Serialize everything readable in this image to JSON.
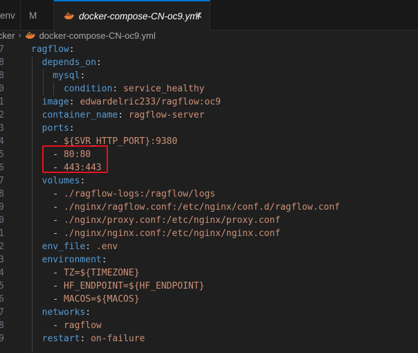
{
  "tabs": [
    {
      "label": "env"
    },
    {
      "label": "M"
    },
    {
      "label": "docker-compose-CN-oc9.yml",
      "active": true
    }
  ],
  "breadcrumb": {
    "folder": "cker",
    "file": "docker-compose-CN-oc9.yml"
  },
  "colors": {
    "key": "#569cd6",
    "value": "#ce9178",
    "punct": "#cccccc",
    "accent": "#0078d4",
    "annotation": "#e81123"
  },
  "lines": [
    {
      "n": "7",
      "segs": [
        {
          "t": "ragflow",
          "c": "k"
        },
        {
          "t": ":",
          "c": "p"
        }
      ]
    },
    {
      "n": "8",
      "segs": [
        {
          "t": "  depends_on",
          "c": "k"
        },
        {
          "t": ":",
          "c": "p"
        }
      ]
    },
    {
      "n": "8",
      "segs": [
        {
          "t": "    mysql",
          "c": "k"
        },
        {
          "t": ":",
          "c": "p"
        }
      ]
    },
    {
      "n": "0",
      "segs": [
        {
          "t": "      condition",
          "c": "k"
        },
        {
          "t": ": ",
          "c": "p"
        },
        {
          "t": "service_healthy",
          "c": "v"
        }
      ]
    },
    {
      "n": "1",
      "segs": [
        {
          "t": "  image",
          "c": "k"
        },
        {
          "t": ": ",
          "c": "p"
        },
        {
          "t": "edwardelric233/ragflow:oc9",
          "c": "v"
        }
      ]
    },
    {
      "n": "2",
      "segs": [
        {
          "t": "  container_name",
          "c": "k"
        },
        {
          "t": ": ",
          "c": "p"
        },
        {
          "t": "ragflow-server",
          "c": "v"
        }
      ]
    },
    {
      "n": "3",
      "segs": [
        {
          "t": "  ports",
          "c": "k"
        },
        {
          "t": ":",
          "c": "p"
        }
      ]
    },
    {
      "n": "4",
      "segs": [
        {
          "t": "    - ",
          "c": "p"
        },
        {
          "t": "${SVR_HTTP_PORT}:9380",
          "c": "v"
        }
      ]
    },
    {
      "n": "5",
      "segs": [
        {
          "t": "    - ",
          "c": "p"
        },
        {
          "t": "80:80",
          "c": "v"
        }
      ]
    },
    {
      "n": "6",
      "segs": [
        {
          "t": "    - ",
          "c": "p"
        },
        {
          "t": "443:443",
          "c": "v"
        }
      ]
    },
    {
      "n": "7",
      "segs": [
        {
          "t": "  volumes",
          "c": "k"
        },
        {
          "t": ":",
          "c": "p"
        }
      ]
    },
    {
      "n": "8",
      "segs": [
        {
          "t": "    - ",
          "c": "p"
        },
        {
          "t": "./ragflow-logs:/ragflow/logs",
          "c": "v"
        }
      ]
    },
    {
      "n": "9",
      "segs": [
        {
          "t": "    - ",
          "c": "p"
        },
        {
          "t": "./nginx/ragflow.conf:/etc/nginx/conf.d/ragflow.conf",
          "c": "v"
        }
      ]
    },
    {
      "n": "0",
      "segs": [
        {
          "t": "    - ",
          "c": "p"
        },
        {
          "t": "./nginx/proxy.conf:/etc/nginx/proxy.conf",
          "c": "v"
        }
      ]
    },
    {
      "n": "1",
      "segs": [
        {
          "t": "    - ",
          "c": "p"
        },
        {
          "t": "./nginx/nginx.conf:/etc/nginx/nginx.conf",
          "c": "v"
        }
      ]
    },
    {
      "n": "2",
      "segs": [
        {
          "t": "  env_file",
          "c": "k"
        },
        {
          "t": ": ",
          "c": "p"
        },
        {
          "t": ".env",
          "c": "v"
        }
      ]
    },
    {
      "n": "3",
      "segs": [
        {
          "t": "  environment",
          "c": "k"
        },
        {
          "t": ":",
          "c": "p"
        }
      ]
    },
    {
      "n": "4",
      "segs": [
        {
          "t": "    - ",
          "c": "p"
        },
        {
          "t": "TZ=${TIMEZONE}",
          "c": "v"
        }
      ]
    },
    {
      "n": "5",
      "segs": [
        {
          "t": "    - ",
          "c": "p"
        },
        {
          "t": "HF_ENDPOINT=${HF_ENDPOINT}",
          "c": "v"
        }
      ]
    },
    {
      "n": "6",
      "segs": [
        {
          "t": "    - ",
          "c": "p"
        },
        {
          "t": "MACOS=${MACOS}",
          "c": "v"
        }
      ]
    },
    {
      "n": "7",
      "segs": [
        {
          "t": "  networks",
          "c": "k"
        },
        {
          "t": ":",
          "c": "p"
        }
      ]
    },
    {
      "n": "8",
      "segs": [
        {
          "t": "    - ",
          "c": "p"
        },
        {
          "t": "ragflow",
          "c": "v"
        }
      ]
    },
    {
      "n": "9",
      "segs": [
        {
          "t": "  restart",
          "c": "k"
        },
        {
          "t": ": ",
          "c": "p"
        },
        {
          "t": "on-failure",
          "c": "v"
        }
      ]
    }
  ]
}
